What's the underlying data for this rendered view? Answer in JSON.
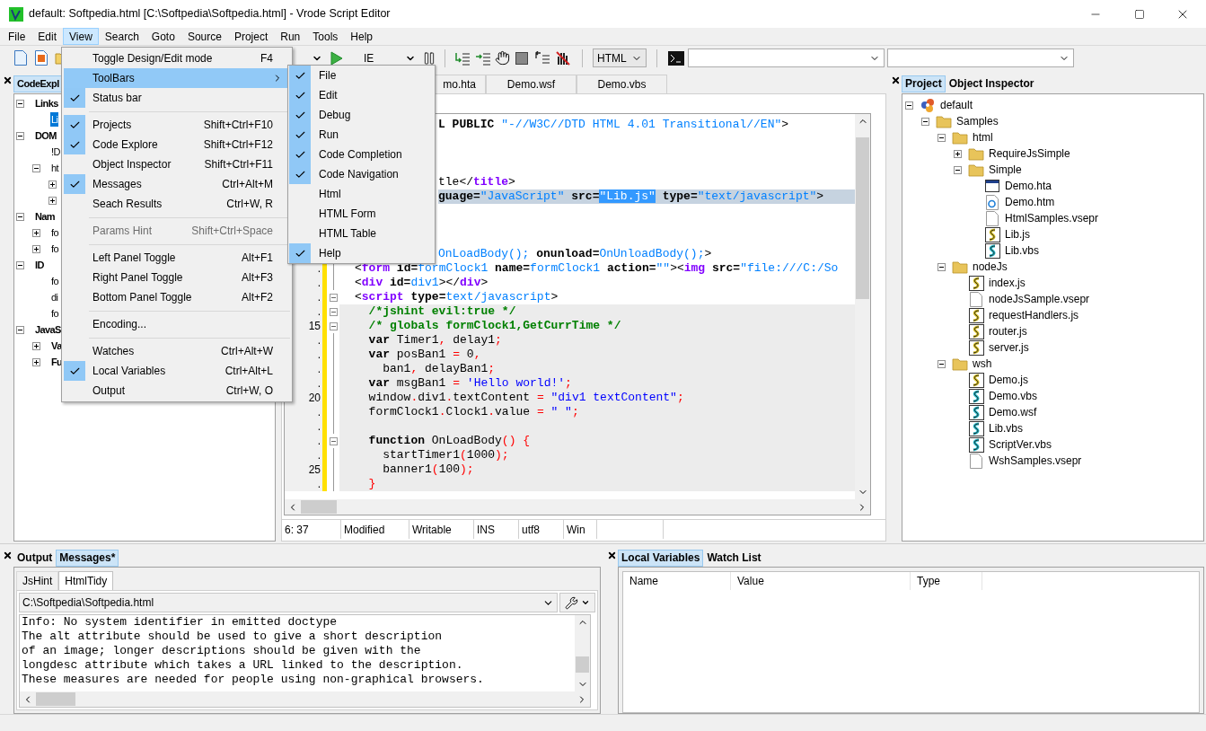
{
  "window": {
    "title": "default: Softpedia.html [C:\\Softpedia\\Softpedia.html] - Vrode Script Editor"
  },
  "menu_bar": [
    {
      "label": "File",
      "selected": false
    },
    {
      "label": "Edit",
      "selected": false
    },
    {
      "label": "View",
      "selected": true
    },
    {
      "label": "Search",
      "selected": false
    },
    {
      "label": "Goto",
      "selected": false
    },
    {
      "label": "Source",
      "selected": false
    },
    {
      "label": "Project",
      "selected": false
    },
    {
      "label": "Run",
      "selected": false
    },
    {
      "label": "Tools",
      "selected": false
    },
    {
      "label": "Help",
      "selected": false
    }
  ],
  "toolbar": {
    "browser": "IE",
    "language": "HTML"
  },
  "left_panel": {
    "tab": "CodeExpl",
    "tree": [
      {
        "label": "Links",
        "bold": true,
        "selected": false,
        "expanded": true,
        "children": [
          {
            "label": "Li",
            "bold": false,
            "selected": true
          }
        ]
      },
      {
        "label": "DOM",
        "bold": true,
        "selected": false,
        "expanded": true,
        "children": [
          {
            "label": "!D",
            "bold": false,
            "selected": false
          },
          {
            "label": "ht",
            "bold": false,
            "selected": false,
            "expanded": true,
            "children": [
              {
                "expanded": false
              },
              {
                "expanded": false
              }
            ]
          }
        ]
      },
      {
        "label": "Nam",
        "bold": true,
        "selected": false,
        "expanded": true,
        "children": [
          {
            "label": "fo",
            "bold": false,
            "selected": false,
            "expanded": false
          },
          {
            "label": "fo",
            "bold": false,
            "selected": false,
            "expanded": false
          }
        ]
      },
      {
        "label": "ID",
        "bold": true,
        "selected": false,
        "expanded": true,
        "children": [
          {
            "label": "fo",
            "bold": false,
            "selected": false
          },
          {
            "label": "di",
            "bold": false,
            "selected": false
          },
          {
            "label": "fo",
            "bold": false,
            "selected": false
          }
        ]
      },
      {
        "label": "JavaS",
        "bold": true,
        "selected": false,
        "expanded": true,
        "children": [
          {
            "label": "Va",
            "bold": true,
            "selected": false,
            "expanded": false
          },
          {
            "label": "Fu",
            "bold": true,
            "selected": false,
            "expanded": false
          }
        ]
      }
    ]
  },
  "editor": {
    "tabs": [
      {
        "label": "mo.hta"
      },
      {
        "label": "Demo.wsf"
      },
      {
        "label": "Demo.vbs"
      }
    ],
    "lines": [
      {
        "kind": "code",
        "cut": true,
        "current": false,
        "shaded": false,
        "tokens": [
          {
            "t": "L PUBLIC",
            "kind": "bold"
          },
          {
            "t": " \"-//W3C//DTD HTML 4.01 Transitional//EN\"",
            "kind": "value"
          },
          {
            "t": ">",
            "kind": "plain"
          }
        ]
      },
      {
        "kind": "blank"
      },
      {
        "kind": "blank"
      },
      {
        "kind": "blank"
      },
      {
        "kind": "code",
        "cut": true,
        "current": false,
        "shaded": false,
        "tokens": [
          {
            "t": "tle</",
            "kind": "plain"
          },
          {
            "t": "title",
            "kind": "tag"
          },
          {
            "t": ">",
            "kind": "plain"
          }
        ]
      },
      {
        "kind": "code",
        "cut": true,
        "current": true,
        "tokens": [
          {
            "t": "guage=",
            "kind": "bold"
          },
          {
            "t": "\"JavaScript\"",
            "kind": "value"
          },
          {
            "t": " src=",
            "kind": "bold"
          },
          {
            "t": "\"Lib.js\"",
            "kind": "sel"
          },
          {
            "t": " type=",
            "kind": "bold"
          },
          {
            "t": "\"text/javascript\"",
            "kind": "value"
          },
          {
            "t": ">",
            "kind": "plain"
          }
        ]
      },
      {
        "kind": "blank"
      },
      {
        "kind": "blank"
      },
      {
        "kind": "blank"
      },
      {
        "kind": "code",
        "cut": true,
        "current": false,
        "shaded": false,
        "tokens": [
          {
            "t": "OnLoadBody();",
            "kind": "value"
          },
          {
            "t": " onunload=",
            "kind": "bold"
          },
          {
            "t": "OnUnloadBody();",
            "kind": "value"
          },
          {
            "t": ">",
            "kind": "plain"
          }
        ]
      },
      {
        "kind": "code",
        "number": ".",
        "fold": false,
        "modified": true,
        "cut": false,
        "current": false,
        "shaded": false,
        "tokens": [
          {
            "t": "<",
            "kind": "plain"
          },
          {
            "t": "form",
            "kind": "tag"
          },
          {
            "t": " id=",
            "kind": "bold"
          },
          {
            "t": "formClock1",
            "kind": "value"
          },
          {
            "t": " name=",
            "kind": "bold"
          },
          {
            "t": "formClock1",
            "kind": "value"
          },
          {
            "t": " action=",
            "kind": "bold"
          },
          {
            "t": "\"\"",
            "kind": "value"
          },
          {
            "t": "><",
            "kind": "plain"
          },
          {
            "t": "img",
            "kind": "tag"
          },
          {
            "t": " src=",
            "kind": "bold"
          },
          {
            "t": "\"file:///C:/So",
            "kind": "value"
          }
        ]
      },
      {
        "kind": "code",
        "number": ".",
        "fold": false,
        "modified": true,
        "cut": false,
        "current": false,
        "shaded": false,
        "tokens": [
          {
            "t": "<",
            "kind": "plain"
          },
          {
            "t": "div",
            "kind": "tag"
          },
          {
            "t": " id=",
            "kind": "bold"
          },
          {
            "t": "div1",
            "kind": "value"
          },
          {
            "t": "></",
            "kind": "plain"
          },
          {
            "t": "div",
            "kind": "tag"
          },
          {
            "t": ">",
            "kind": "plain"
          }
        ]
      },
      {
        "kind": "code",
        "number": ".",
        "fold": true,
        "modified": true,
        "cut": false,
        "current": false,
        "shaded": false,
        "tokens": [
          {
            "t": "<",
            "kind": "plain"
          },
          {
            "t": "script",
            "kind": "tag"
          },
          {
            "t": " type=",
            "kind": "bold"
          },
          {
            "t": "text/javascript",
            "kind": "value"
          },
          {
            "t": ">",
            "kind": "plain"
          }
        ]
      },
      {
        "kind": "code",
        "number": ".",
        "fold": true,
        "modified": true,
        "cut": false,
        "current": false,
        "shaded": true,
        "tokens": [
          {
            "t": "  /*jshint evil:true */",
            "kind": "comment"
          }
        ]
      },
      {
        "kind": "code",
        "number": "15",
        "fold": true,
        "modified": true,
        "cut": false,
        "current": false,
        "shaded": true,
        "tokens": [
          {
            "t": "  /* globals formClock1,GetCurrTime */",
            "kind": "comment"
          }
        ]
      },
      {
        "kind": "code",
        "number": ".",
        "fold": false,
        "modified": true,
        "cut": false,
        "current": false,
        "shaded": true,
        "tokens": [
          {
            "t": "  var",
            "kind": "bold"
          },
          {
            "t": " Timer1",
            "kind": "plain"
          },
          {
            "t": ",",
            "kind": "punct"
          },
          {
            "t": " delay1",
            "kind": "plain"
          },
          {
            "t": ";",
            "kind": "punct"
          }
        ]
      },
      {
        "kind": "code",
        "number": ".",
        "fold": false,
        "modified": true,
        "cut": false,
        "current": false,
        "shaded": true,
        "tokens": [
          {
            "t": "  var",
            "kind": "bold"
          },
          {
            "t": " posBan1 ",
            "kind": "plain"
          },
          {
            "t": "=",
            "kind": "punct"
          },
          {
            "t": " 0",
            "kind": "plain"
          },
          {
            "t": ",",
            "kind": "punct"
          }
        ]
      },
      {
        "kind": "code",
        "number": ".",
        "fold": false,
        "modified": true,
        "cut": false,
        "current": false,
        "shaded": true,
        "tokens": [
          {
            "t": "    ban1",
            "kind": "plain"
          },
          {
            "t": ",",
            "kind": "punct"
          },
          {
            "t": " delayBan1",
            "kind": "plain"
          },
          {
            "t": ";",
            "kind": "punct"
          }
        ]
      },
      {
        "kind": "code",
        "number": ".",
        "fold": false,
        "modified": true,
        "cut": false,
        "current": false,
        "shaded": true,
        "tokens": [
          {
            "t": "  var",
            "kind": "bold"
          },
          {
            "t": " msgBan1 ",
            "kind": "plain"
          },
          {
            "t": "= ",
            "kind": "punct"
          },
          {
            "t": "'Hello world!'",
            "kind": "str"
          },
          {
            "t": ";",
            "kind": "punct"
          }
        ]
      },
      {
        "kind": "code",
        "number": "20",
        "fold": false,
        "modified": true,
        "cut": false,
        "current": false,
        "shaded": true,
        "tokens": [
          {
            "t": "  window",
            "kind": "plain"
          },
          {
            "t": ".",
            "kind": "punct"
          },
          {
            "t": "div1",
            "kind": "plain"
          },
          {
            "t": ".",
            "kind": "punct"
          },
          {
            "t": "textContent ",
            "kind": "plain"
          },
          {
            "t": "= ",
            "kind": "punct"
          },
          {
            "t": "\"div1 textContent\"",
            "kind": "str"
          },
          {
            "t": ";",
            "kind": "punct"
          }
        ]
      },
      {
        "kind": "code",
        "number": ".",
        "fold": false,
        "modified": true,
        "cut": false,
        "current": false,
        "shaded": true,
        "tokens": [
          {
            "t": "  formClock1",
            "kind": "plain"
          },
          {
            "t": ".",
            "kind": "punct"
          },
          {
            "t": "Clock1",
            "kind": "plain"
          },
          {
            "t": ".",
            "kind": "punct"
          },
          {
            "t": "value ",
            "kind": "plain"
          },
          {
            "t": "= ",
            "kind": "punct"
          },
          {
            "t": "\" \"",
            "kind": "str"
          },
          {
            "t": ";",
            "kind": "punct"
          }
        ]
      },
      {
        "kind": "blank",
        "number": ".",
        "fold": false,
        "modified": true,
        "current": false,
        "shaded": true
      },
      {
        "kind": "code",
        "number": ".",
        "fold": true,
        "modified": true,
        "cut": false,
        "current": false,
        "shaded": true,
        "tokens": [
          {
            "t": "  function",
            "kind": "bold"
          },
          {
            "t": " OnLoadBody",
            "kind": "plain"
          },
          {
            "t": "() {",
            "kind": "punct"
          }
        ]
      },
      {
        "kind": "code",
        "number": ".",
        "fold": false,
        "modified": true,
        "cut": false,
        "current": false,
        "shaded": true,
        "tokens": [
          {
            "t": "    startTimer1",
            "kind": "plain"
          },
          {
            "t": "(",
            "kind": "punct"
          },
          {
            "t": "1000",
            "kind": "plain"
          },
          {
            "t": ");",
            "kind": "punct"
          }
        ]
      },
      {
        "kind": "code",
        "number": "25",
        "fold": false,
        "modified": true,
        "cut": false,
        "current": false,
        "shaded": true,
        "tokens": [
          {
            "t": "    banner1",
            "kind": "plain"
          },
          {
            "t": "(",
            "kind": "punct"
          },
          {
            "t": "100",
            "kind": "plain"
          },
          {
            "t": ");",
            "kind": "punct"
          }
        ]
      },
      {
        "kind": "code",
        "number": ".",
        "fold": false,
        "modified": true,
        "cut": false,
        "current": false,
        "shaded": true,
        "tokens": [
          {
            "t": "  }",
            "kind": "punct"
          }
        ]
      }
    ],
    "status": [
      "6: 37",
      "Modified",
      "Writable",
      "INS",
      "utf8",
      "Win"
    ]
  },
  "right_panel": {
    "tabs": [
      {
        "label": "Project",
        "selected": true
      },
      {
        "label": "Object Inspector",
        "selected": false
      }
    ],
    "tree": [
      {
        "label": "default",
        "kind": "project",
        "expanded": true,
        "children": [
          {
            "label": "Samples",
            "kind": "folder",
            "expanded": true,
            "children": [
              {
                "label": "html",
                "kind": "folder",
                "expanded": true,
                "children": [
                  {
                    "label": "RequireJsSimple",
                    "kind": "folder",
                    "expanded": false
                  },
                  {
                    "label": "Simple",
                    "kind": "folder",
                    "expanded": true,
                    "children": [
                      {
                        "label": "Demo.hta",
                        "kind": "hta"
                      },
                      {
                        "label": "Demo.htm",
                        "kind": "htm"
                      },
                      {
                        "label": "HtmlSamples.vsepr",
                        "kind": "doc"
                      },
                      {
                        "label": "Lib.js",
                        "kind": "js"
                      },
                      {
                        "label": "Lib.vbs",
                        "kind": "vbs"
                      }
                    ]
                  }
                ]
              },
              {
                "label": "nodeJs",
                "kind": "folder",
                "expanded": true,
                "children": [
                  {
                    "label": "index.js",
                    "kind": "js"
                  },
                  {
                    "label": "nodeJsSample.vsepr",
                    "kind": "doc"
                  },
                  {
                    "label": "requestHandlers.js",
                    "kind": "js"
                  },
                  {
                    "label": "router.js",
                    "kind": "js"
                  },
                  {
                    "label": "server.js",
                    "kind": "js"
                  }
                ]
              },
              {
                "label": "wsh",
                "kind": "folder",
                "expanded": true,
                "children": [
                  {
                    "label": "Demo.js",
                    "kind": "js"
                  },
                  {
                    "label": "Demo.vbs",
                    "kind": "vbs"
                  },
                  {
                    "label": "Demo.wsf",
                    "kind": "vbs"
                  },
                  {
                    "label": "Lib.vbs",
                    "kind": "vbs"
                  },
                  {
                    "label": "ScriptVer.vbs",
                    "kind": "vbs"
                  },
                  {
                    "label": "WshSamples.vsepr",
                    "kind": "doc"
                  }
                ]
              }
            ]
          }
        ]
      }
    ]
  },
  "messages_panel": {
    "tabs": [
      {
        "label": "Output",
        "selected": false
      },
      {
        "label": "Messages*",
        "selected": true
      }
    ],
    "subtabs": [
      {
        "label": "JsHint",
        "selected": false
      },
      {
        "label": "HtmlTidy",
        "selected": true
      }
    ],
    "path": "C:\\Softpedia\\Softpedia.html",
    "lines": [
      "Info: No system identifier in emitted doctype",
      "The alt attribute should be used to give a short description",
      "of an image; longer descriptions should be given with the",
      "longdesc attribute which takes a URL linked to the description.",
      "These measures are needed for people using non-graphical browsers."
    ]
  },
  "variables_panel": {
    "tabs": [
      {
        "label": "Local Variables",
        "selected": true
      },
      {
        "label": "Watch List",
        "selected": false
      }
    ],
    "columns": [
      "Name",
      "Value",
      "Type"
    ]
  },
  "view_menu": [
    {
      "kind": "item",
      "label": "Toggle Design/Edit mode",
      "shortcut": "F4",
      "checked": false,
      "disabled": false,
      "selected": false
    },
    {
      "kind": "submenu",
      "label": "ToolBars",
      "checked": false,
      "disabled": false,
      "selected": true
    },
    {
      "kind": "item",
      "label": "Status bar",
      "checked": true,
      "disabled": false,
      "selected": false
    },
    {
      "kind": "separator"
    },
    {
      "kind": "item",
      "label": "Projects",
      "shortcut": "Shift+Ctrl+F10",
      "checked": true,
      "disabled": false,
      "selected": false
    },
    {
      "kind": "item",
      "label": "Code Explore",
      "shortcut": "Shift+Ctrl+F12",
      "checked": true,
      "disabled": false,
      "selected": false
    },
    {
      "kind": "item",
      "label": "Object Inspector",
      "shortcut": "Shift+Ctrl+F11",
      "checked": false,
      "disabled": false,
      "selected": false
    },
    {
      "kind": "item",
      "label": "Messages",
      "shortcut": "Ctrl+Alt+M",
      "checked": true,
      "disabled": false,
      "selected": false
    },
    {
      "kind": "item",
      "label": "Seach Results",
      "shortcut": "Ctrl+W, R",
      "checked": false,
      "disabled": false,
      "selected": false
    },
    {
      "kind": "separator"
    },
    {
      "kind": "item",
      "label": "Params Hint",
      "shortcut": "Shift+Ctrl+Space",
      "checked": false,
      "disabled": true,
      "selected": false
    },
    {
      "kind": "separator"
    },
    {
      "kind": "item",
      "label": "Left Panel Toggle",
      "shortcut": "Alt+F1",
      "checked": false,
      "disabled": false,
      "selected": false
    },
    {
      "kind": "item",
      "label": "Right Panel Toggle",
      "shortcut": "Alt+F3",
      "checked": false,
      "disabled": false,
      "selected": false
    },
    {
      "kind": "item",
      "label": "Bottom Panel Toggle",
      "shortcut": "Alt+F2",
      "checked": false,
      "disabled": false,
      "selected": false
    },
    {
      "kind": "separator"
    },
    {
      "kind": "item",
      "label": "Encoding...",
      "checked": false,
      "disabled": false,
      "selected": false
    },
    {
      "kind": "separator"
    },
    {
      "kind": "item",
      "label": "Watches",
      "shortcut": "Ctrl+Alt+W",
      "checked": false,
      "disabled": false,
      "selected": false
    },
    {
      "kind": "item",
      "label": "Local Variables",
      "shortcut": "Ctrl+Alt+L",
      "checked": true,
      "disabled": false,
      "selected": false
    },
    {
      "kind": "item",
      "label": "Output",
      "shortcut": "Ctrl+W, O",
      "checked": false,
      "disabled": false,
      "selected": false
    }
  ],
  "toolbars_menu": [
    {
      "label": "File",
      "checked": true
    },
    {
      "label": "Edit",
      "checked": true
    },
    {
      "label": "Debug",
      "checked": true
    },
    {
      "label": "Run",
      "checked": true
    },
    {
      "label": "Code Completion",
      "checked": true
    },
    {
      "label": "Code Navigation",
      "checked": true
    },
    {
      "label": "Html",
      "checked": false
    },
    {
      "label": "HTML Form",
      "checked": false
    },
    {
      "label": "HTML Table",
      "checked": false
    },
    {
      "label": "Help",
      "checked": true
    }
  ]
}
